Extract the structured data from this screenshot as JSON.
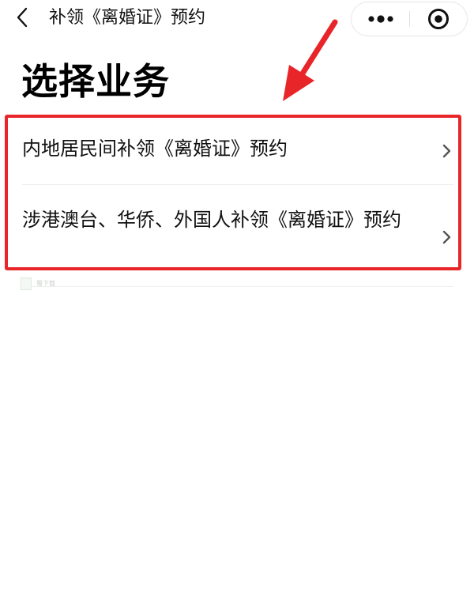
{
  "nav": {
    "title": "补领《离婚证》预约",
    "back_icon": "chevron-left-icon",
    "more_icon": "more-dots-icon",
    "close_icon": "target-close-icon"
  },
  "page": {
    "title": "选择业务"
  },
  "services": [
    {
      "label": "内地居民间补领《离婚证》预约"
    },
    {
      "label": "涉港澳台、华侨、外国人补领《离婚证》预约"
    }
  ],
  "watermark": {
    "text": "蜀下载"
  },
  "colors": {
    "highlight": "#e8262a",
    "text": "#111111",
    "divider": "#eeeeee"
  }
}
